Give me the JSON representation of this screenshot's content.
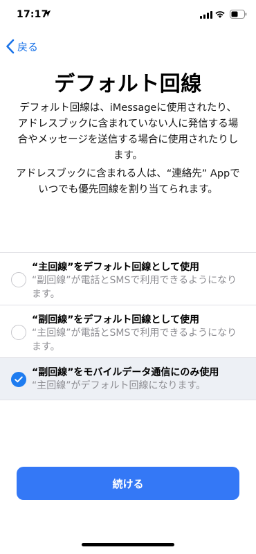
{
  "status_bar": {
    "time": "17:17",
    "icons": [
      "location-arrow-icon",
      "signal-icon",
      "wifi-icon",
      "battery-icon"
    ]
  },
  "nav": {
    "back_label": "戻る",
    "accent_color": "#1a73e8"
  },
  "title": "デフォルト回線",
  "description": {
    "paragraph1": "デフォルト回線は、iMessageに使用されたり、アドレスブックに含まれていない人に発信する場合やメッセージを送信する場合に使用されたりします。",
    "paragraph2": "アドレスブックに含まれる人は、“連絡先” Appでいつでも優先回線を割り当てられます。"
  },
  "options": [
    {
      "title": "“主回線”をデフォルト回線として使用",
      "subtitle": "“副回線”が電話とSMSで利用できるようになります。",
      "selected": false
    },
    {
      "title": "“副回線”をデフォルト回線として使用",
      "subtitle": "“主回線”が電話とSMSで利用できるようになります。",
      "selected": false
    },
    {
      "title": "“副回線”をモバイルデータ通信にのみ使用",
      "subtitle": "“主回線”がデフォルト回線になります。",
      "selected": true
    }
  ],
  "continue_label": "続ける",
  "colors": {
    "button": "#3478f6",
    "selected_row": "#edf0f5",
    "radio_checked": "#1e7cf0",
    "subtitle_gray": "#8e8e93"
  }
}
